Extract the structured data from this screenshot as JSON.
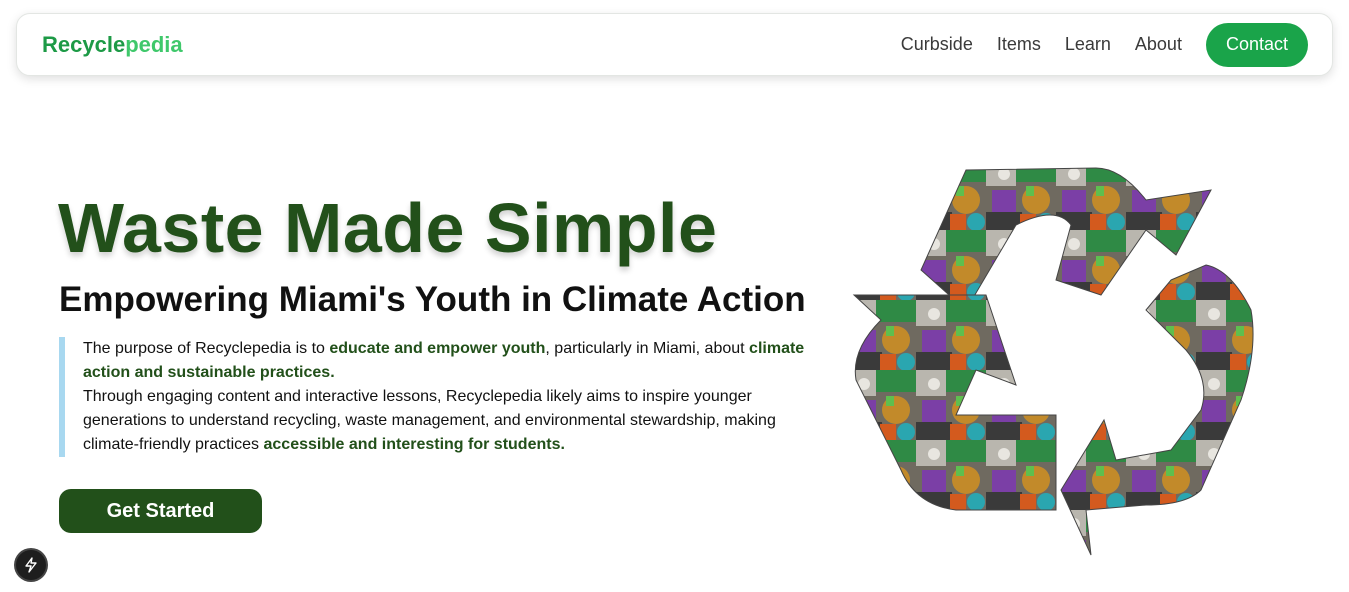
{
  "nav": {
    "brand_part1": "Recycle",
    "brand_part2": "pedia",
    "links": [
      "Curbside",
      "Items",
      "Learn",
      "About"
    ],
    "contact_label": "Contact"
  },
  "hero": {
    "title": "Waste Made Simple",
    "subtitle": "Empowering Miami's Youth in Climate Action",
    "paragraph": {
      "p1_a": "The purpose of Recyclepedia is to ",
      "p1_b": "educate and empower youth",
      "p1_c": ", particularly in Miami, about ",
      "p1_d": "climate action and sustainable practices",
      "p1_e": ".",
      "p2_a": "Through engaging content and interactive lessons, Recyclepedia likely aims to inspire younger generations to understand recycling, waste management, and environmental stewardship, making climate-friendly practices ",
      "p2_b": "accessible and interesting for students",
      "p2_c": "."
    },
    "cta_label": "Get Started"
  },
  "graphic": {
    "icon": "recycle-icon",
    "colors": {
      "accent_green": "#1aa44a",
      "dark_green": "#22501a",
      "quote_bar": "#a8d8f0"
    }
  },
  "badge": {
    "icon": "lightning-icon"
  }
}
